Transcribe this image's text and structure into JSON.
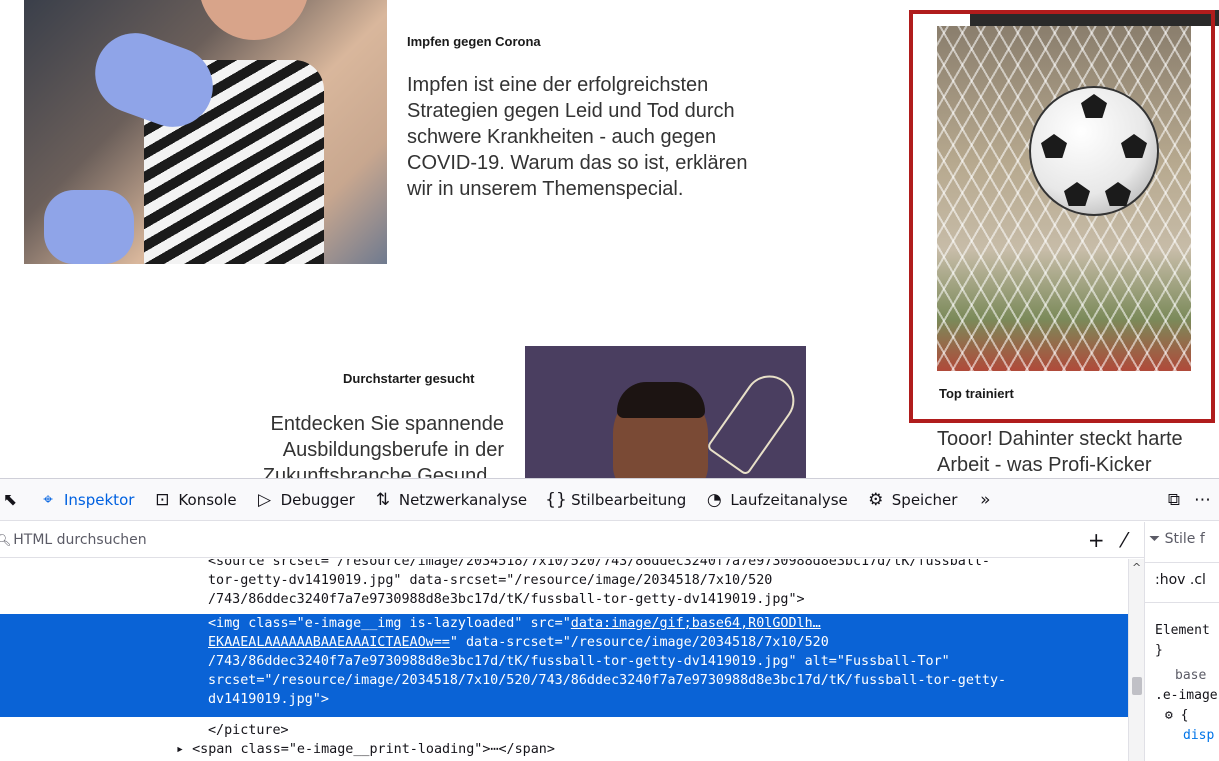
{
  "page": {
    "corona": {
      "title": "Impfen gegen Corona",
      "lines": [
        "Impfen ist eine der erfolgreichsten",
        "Strategien gegen Leid und Tod durch",
        "schwere Krankheiten - auch gegen",
        "COVID-19. Warum das so ist, erklären",
        "wir in unserem Themenspecial."
      ]
    },
    "fussball": {
      "title": "Top trainiert",
      "lines": [
        "Tooor! Dahinter steckt harte",
        "Arbeit - was Profi-Kicker"
      ]
    },
    "ausbildung": {
      "title": "Durchstarter gesucht",
      "lines": [
        "Entdecken Sie spannende",
        "Ausbildungsberufe in der",
        "Zukunftsbranche Gesund..."
      ]
    },
    "colors": {
      "highlight_border": "#b01c1c",
      "accent_blue": "#1f7fcf"
    }
  },
  "devtools": {
    "tabs": [
      {
        "label": "Inspektor",
        "icon": "inspector-icon"
      },
      {
        "label": "Konsole",
        "icon": "console-icon"
      },
      {
        "label": "Debugger",
        "icon": "debugger-icon"
      },
      {
        "label": "Netzwerkanalyse",
        "icon": "network-icon"
      },
      {
        "label": "Stilbearbeitung",
        "icon": "style-editor-icon"
      },
      {
        "label": "Laufzeitanalyse",
        "icon": "performance-icon"
      },
      {
        "label": "Speicher",
        "icon": "memory-icon"
      }
    ],
    "search_placeholder": "HTML durchsuchen",
    "markup": {
      "line1": "<source srcset=\"/resource/image/2034518/7x10/520/743/86ddec3240f7a7e9730988d8e3bc17d/tK/fussball-",
      "line2": "tor-getty-dv1419019.jpg\" data-srcset=\"/resource/image/2034518/7x10/520",
      "line3": "/743/86ddec3240f7a7e9730988d8e3bc17d/tK/fussball-tor-getty-dv1419019.jpg\">",
      "sel1_a": "<img class=\"e-image__img is-lazyloaded\" src=\"",
      "sel1_b": "data:image/gif;base64,R0lGODlh…",
      "sel2_a": "EKAAEALAAAAAABAAEAAAICTAEAOw==",
      "sel2_b": "\" data-srcset=\"/resource/image/2034518/7x10/520",
      "sel3": "/743/86ddec3240f7a7e9730988d8e3bc17d/tK/fussball-tor-getty-dv1419019.jpg\" alt=\"Fussball-Tor\"",
      "sel4": "srcset=\"/resource/image/2034518/7x10/520/743/86ddec3240f7a7e9730988d8e3bc17d/tK/fussball-tor-getty-",
      "sel5": "dv1419019.jpg\">",
      "picture_close": "</picture>",
      "span_line": "<span class=\"e-image__print-loading\">⋯</span>"
    },
    "side": {
      "filter": "Stile f",
      "hov": ":hov  .cl",
      "element": "Element",
      "brace": "}",
      "base": "base",
      "class": ".e-image",
      "gear": "⚙ {",
      "disp": "disp"
    }
  }
}
